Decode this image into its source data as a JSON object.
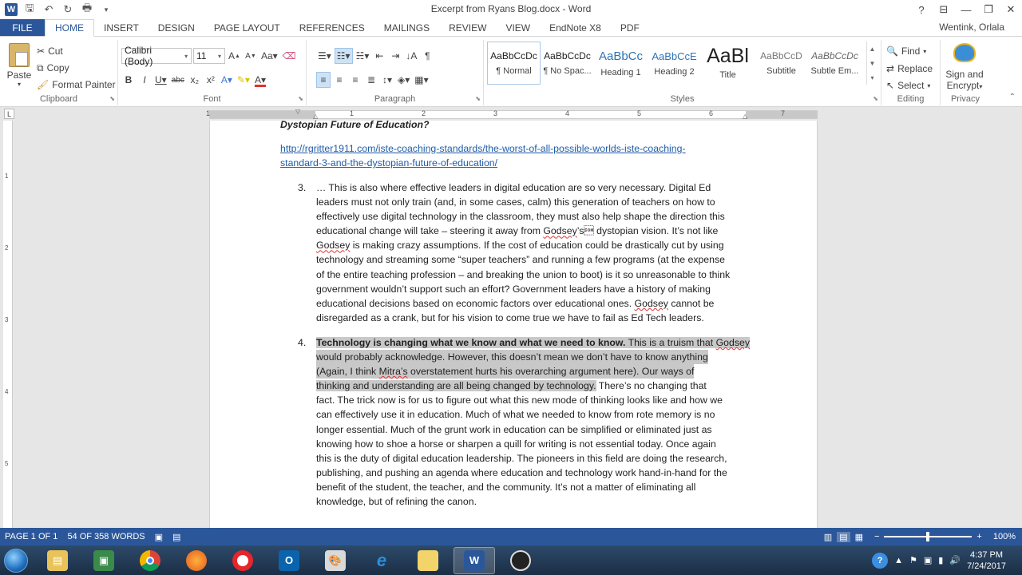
{
  "window": {
    "title": "Excerpt from Ryans Blog.docx - Word",
    "help": "?",
    "controls": [
      "⊟",
      "—",
      "❐",
      "✕"
    ]
  },
  "tabs": {
    "file": "FILE",
    "items": [
      "HOME",
      "INSERT",
      "DESIGN",
      "PAGE LAYOUT",
      "REFERENCES",
      "MAILINGS",
      "REVIEW",
      "VIEW",
      "EndNote X8",
      "PDF"
    ],
    "user": "Wentink, Orlala"
  },
  "ribbon": {
    "clipboard": {
      "paste": "Paste",
      "cut": "Cut",
      "copy": "Copy",
      "format_painter": "Format Painter",
      "label": "Clipboard"
    },
    "font": {
      "name": "Calibri (Body)",
      "size": "11",
      "label": "Font"
    },
    "paragraph": {
      "label": "Paragraph"
    },
    "styles": {
      "label": "Styles",
      "items": [
        {
          "preview": "AaBbCcDc",
          "name": "¶ Normal"
        },
        {
          "preview": "AaBbCcDc",
          "name": "¶ No Spac..."
        },
        {
          "preview": "AaBbCc",
          "name": "Heading 1"
        },
        {
          "preview": "AaBbCcE",
          "name": "Heading 2"
        },
        {
          "preview": "AaBl",
          "name": "Title"
        },
        {
          "preview": "AaBbCcD",
          "name": "Subtitle"
        },
        {
          "preview": "AaBbCcDc",
          "name": "Subtle Em..."
        }
      ]
    },
    "editing": {
      "find": "Find",
      "replace": "Replace",
      "select": "Select",
      "label": "Editing"
    },
    "privacy": {
      "sign1": "Sign and",
      "sign2": "Encrypt",
      "label": "Privacy"
    }
  },
  "ruler": {
    "numbers": [
      "1",
      "1",
      "2",
      "3",
      "4",
      "5",
      "6",
      "7"
    ]
  },
  "vruler": {
    "numbers": [
      "1",
      "2",
      "3",
      "4",
      "5"
    ]
  },
  "document": {
    "cut_heading": "Dystopian Future of Education?",
    "link_line1": "http://rgritter1911.com/iste-coaching-standards/the-worst-of-all-possible-worlds-iste-coaching-",
    "link_line2": "standard-3-and-the-dystopian-future-of-education/",
    "item3": {
      "number": "3.",
      "lines": [
        "… This is also where effective leaders in digital education are so very necessary.  Digital Ed",
        "leaders must not only train (and, in some cases, calm) this generation of teachers on how to",
        "effectively use digital technology in the classroom, they must also help shape the direction this",
        "educational change will take – steering it away from Godsey’s dystopian vision.  It’s not like",
        "Godsey is making crazy assumptions.  If the cost of education could be drastically cut by using",
        "technology and streaming some “super teachers” and running a few programs (at the expense",
        "of the entire teaching profession – and breaking the union to boot) is it so unreasonable to think",
        "government wouldn’t support such an effort?  Government leaders have a history of making",
        "educational decisions based on economic factors over educational ones. Godsey cannot be",
        "disregarded as a crank, but for his vision to come true we have to fail as Ed Tech leaders."
      ]
    },
    "item4": {
      "number": "4.",
      "bold_lead": "Technology is changing what we know and what we need to know.",
      "line1_rest": " This is a truism that Godsey",
      "hl_lines": [
        "would probably acknowledge.  However, this doesn’t mean we don’t have to know anything",
        "(Again, I think Mitra’s overstatement hurts his overarching argument here).  Our ways of"
      ],
      "hl_partial": "thinking and understanding are all being changed by technology.",
      "partial_rest": " There’s no changing that",
      "lines": [
        "fact.  The trick now is for us to figure out what this new mode of thinking looks like and how we",
        "can effectively use it in education. Much of what we needed to know from rote memory is no",
        "longer essential.  Much of the grunt work in education can be simplified or eliminated just as",
        "knowing how to shoe a horse or sharpen a quill for writing is not essential today.  Once again",
        "this is the duty of digital education leadership.  The pioneers in this field are doing the research,",
        "publishing, and pushing an agenda where education and technology work hand-in-hand for the",
        "benefit of the student, the teacher, and the community.  It’s not a matter of eliminating all",
        "knowledge, but of refining the canon."
      ]
    }
  },
  "status": {
    "page": "PAGE 1 OF 1",
    "words": "54 OF 358 WORDS",
    "zoom": "100%",
    "zoom_level": 0.5
  },
  "taskbar": {
    "time": "4:37 PM",
    "date": "7/24/2017",
    "apps": [
      "file-explorer",
      "task-manager",
      "chrome",
      "firefox",
      "opera",
      "outlook",
      "paint",
      "internet-explorer",
      "folder",
      "word",
      "obs"
    ]
  },
  "colors": {
    "accent": "#2b579a",
    "link": "#1f5ca8",
    "highlight": "#c8c8c8"
  }
}
